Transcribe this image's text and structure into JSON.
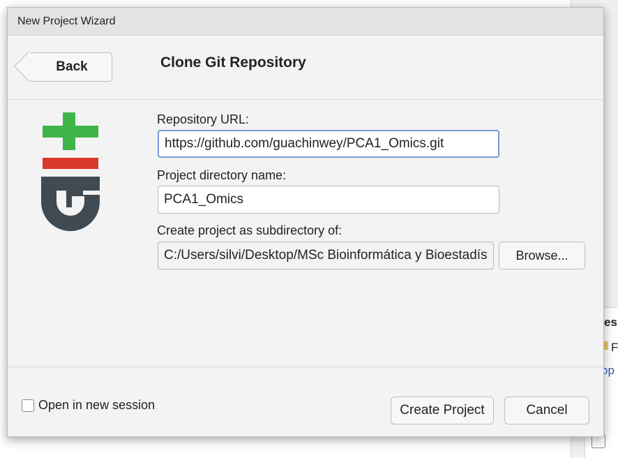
{
  "window": {
    "title": "New Project Wizard"
  },
  "header": {
    "back_label": "Back",
    "title": "Clone Git Repository"
  },
  "logo": {
    "icon": "git-logo-icon",
    "colors": {
      "green": "#3fb549",
      "red": "#d9382b",
      "gray": "#3f4a52"
    }
  },
  "form": {
    "repo_url_label": "Repository URL:",
    "repo_url_value": "https://github.com/guachinwey/PCA1_Omics.git",
    "dir_name_label": "Project directory name:",
    "dir_name_value": "PCA1_Omics",
    "subdir_label": "Create project as subdirectory of:",
    "subdir_value": "C:/Users/silvi/Desktop/MSc Bioinformática y Bioestadíst",
    "browse_label": "Browse..."
  },
  "footer": {
    "new_session_label": "Open in new session",
    "new_session_checked": false,
    "create_label": "Create Project",
    "cancel_label": "Cancel"
  },
  "background": {
    "fragments": [
      "es",
      "Fo",
      "op"
    ]
  }
}
